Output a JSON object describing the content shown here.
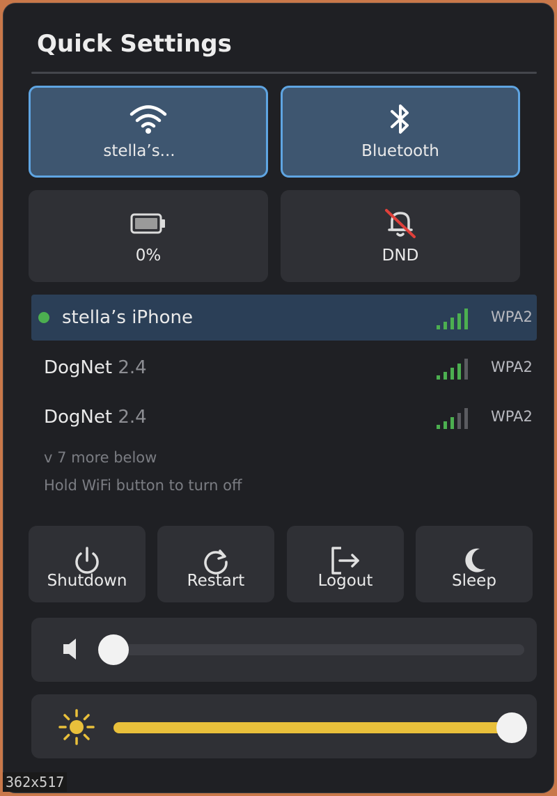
{
  "title": "Quick Settings",
  "tiles": [
    {
      "label": "stella’s...",
      "icon": "wifi-icon",
      "active": true
    },
    {
      "label": "Bluetooth",
      "icon": "bluetooth-icon",
      "active": true
    },
    {
      "label": "0%",
      "icon": "battery-icon",
      "active": false
    },
    {
      "label": "DND",
      "icon": "bell-off-icon",
      "active": false
    }
  ],
  "networks": [
    {
      "ssid": "stella’s iPhone",
      "ssid_suffix": "",
      "security": "WPA2",
      "connected": true,
      "signal_bars": 5
    },
    {
      "ssid": "DogNet",
      "ssid_suffix": "2.4",
      "security": "WPA2",
      "connected": false,
      "signal_bars": 4
    },
    {
      "ssid": "DogNet",
      "ssid_suffix": "2.4",
      "security": "WPA2",
      "connected": false,
      "signal_bars": 3
    }
  ],
  "hints": {
    "more_below": "v 7 more below",
    "wifi_tip": "Hold WiFi button to turn off"
  },
  "power": [
    {
      "label": "Shutdown",
      "icon": "power-icon"
    },
    {
      "label": "Restart",
      "icon": "restart-icon"
    },
    {
      "label": "Logout",
      "icon": "logout-icon"
    },
    {
      "label": "Sleep",
      "icon": "moon-icon"
    }
  ],
  "volume": {
    "level": 0,
    "icon": "speaker-icon"
  },
  "brightness": {
    "level": 1.0,
    "icon": "sun-icon"
  },
  "overlay": {
    "dimensions": "362x517"
  },
  "colors": {
    "accent": "#5fa5e2",
    "active_tile": "#3e5670",
    "connected_dot": "#4caf50",
    "signal_on": "#4caf50",
    "signal_off": "#5a5b60",
    "brightness_fill": "#e9c03b"
  }
}
